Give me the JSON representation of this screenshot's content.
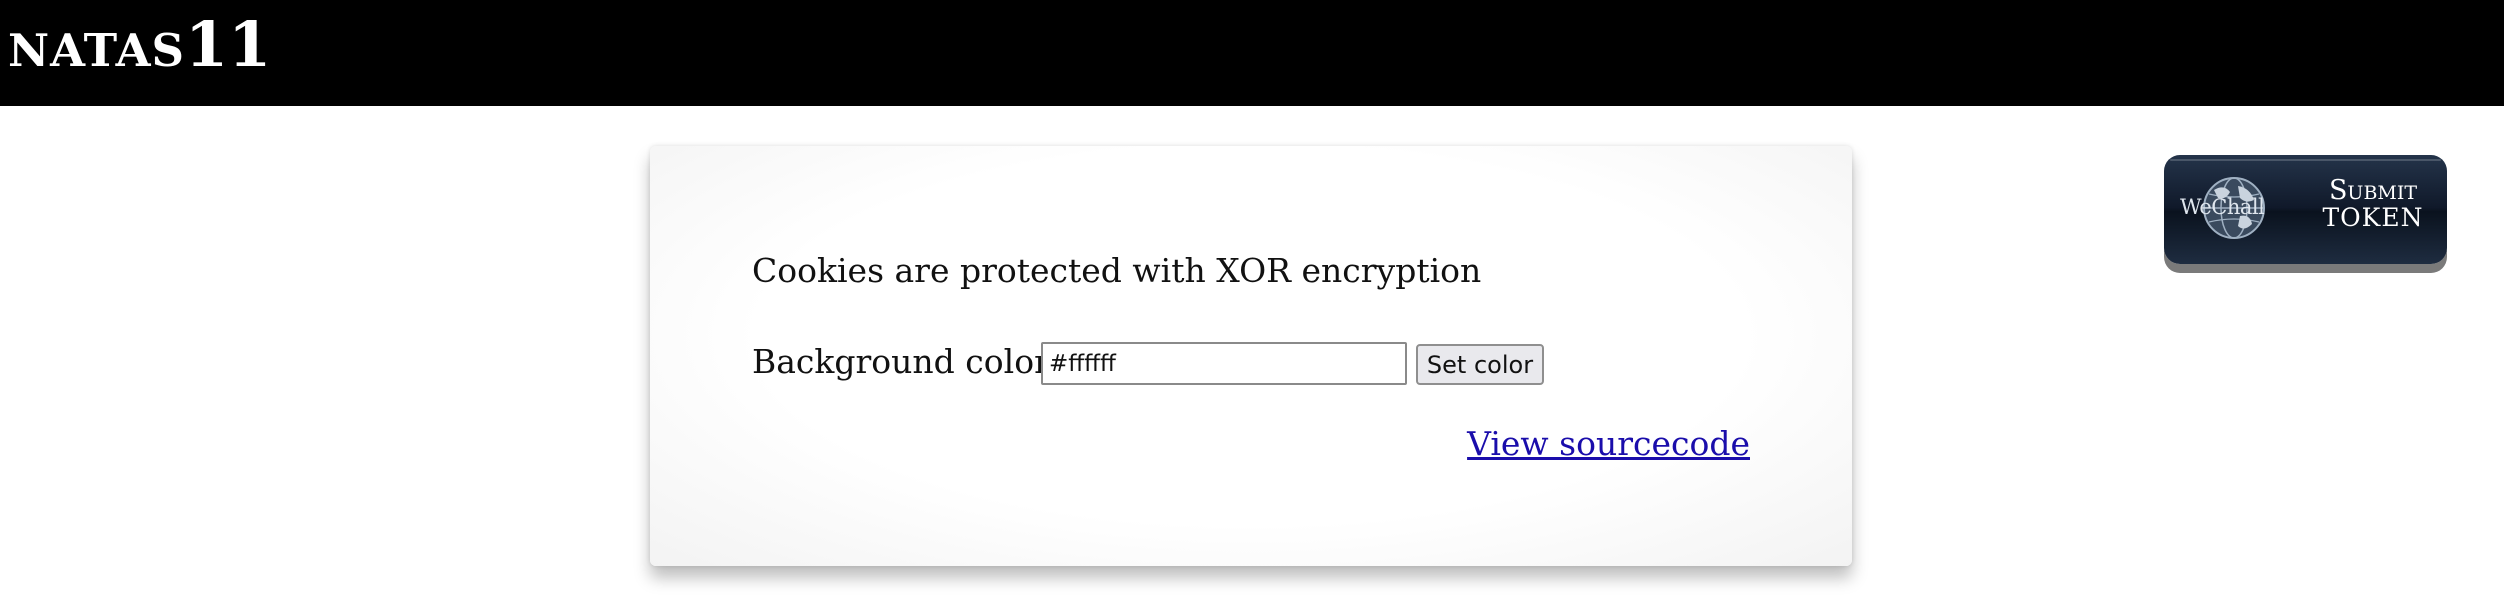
{
  "header": {
    "title_prefix": "NATAS",
    "title_suffix": "11"
  },
  "main": {
    "intro_text": "Cookies are protected with XOR encryption",
    "bg_label": "Background color:",
    "bg_input_value": "#ffffff",
    "set_color_label": "Set color",
    "view_source_label": "View sourcecode"
  },
  "badge": {
    "wechall_text": "WeChall",
    "submit_line1": "Submit",
    "submit_line2": "TOKEN",
    "icon": "globe-icon"
  },
  "colors": {
    "header_bg": "#000000",
    "link": "#1a0dab",
    "badge_bg": "#10192a"
  }
}
